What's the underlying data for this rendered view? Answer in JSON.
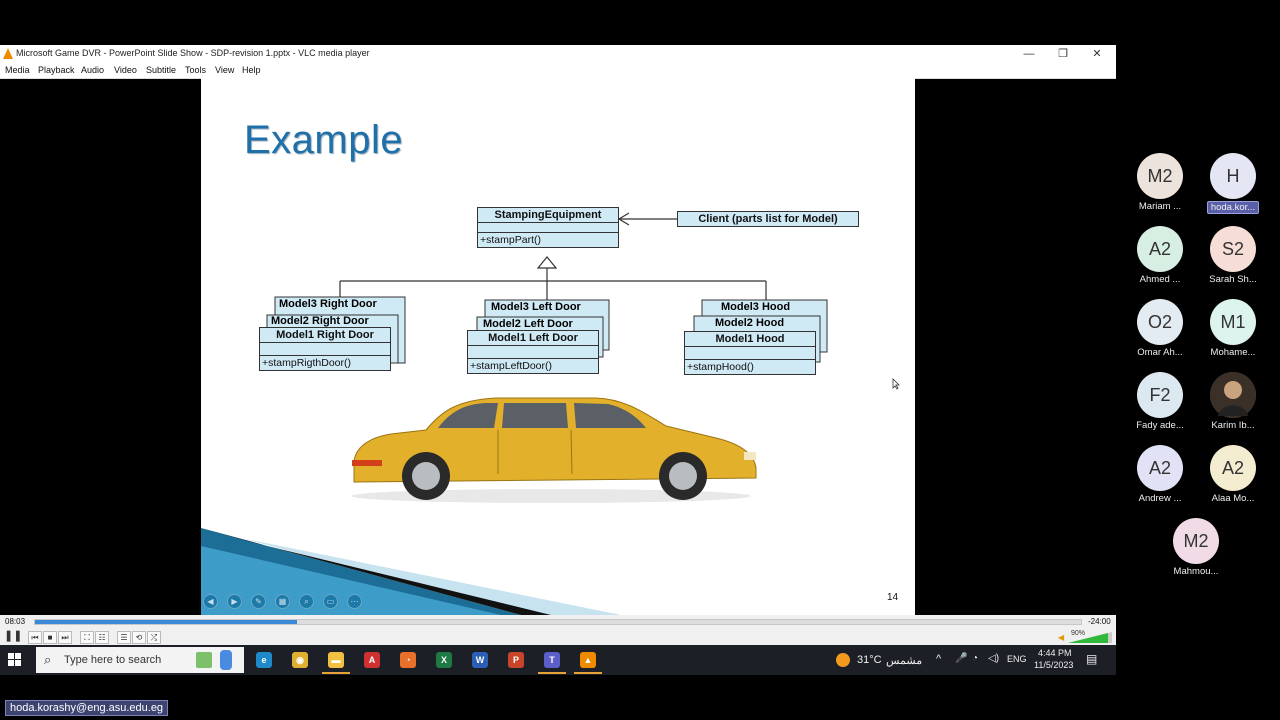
{
  "window": {
    "title": "Microsoft Game DVR - PowerPoint Slide Show  -  SDP-revision 1.pptx - VLC media player",
    "controls": [
      "—",
      "❐",
      "✕"
    ]
  },
  "menu": [
    "Media",
    "Playback",
    "Audio",
    "Video",
    "Subtitle",
    "Tools",
    "View",
    "Help"
  ],
  "slide": {
    "title": "Example",
    "number": "14",
    "uml": {
      "stamping_equipment": {
        "name": "StampingEquipment",
        "op": "+stampPart()"
      },
      "client": "Client (parts list for Model)",
      "right_door": {
        "names": [
          "Model3 Right Door",
          "Model2 Right Door",
          "Model1 Right Door"
        ],
        "op": "+stampRigthDoor()"
      },
      "left_door": {
        "names": [
          "Model3 Left Door",
          "Model2 Left Door",
          "Model1  Left  Door"
        ],
        "op": "+stampLeftDoor()"
      },
      "hood": {
        "names": [
          "Model3 Hood",
          "Model2 Hood",
          "Model1 Hood"
        ],
        "op": "+stampHood()"
      }
    }
  },
  "player": {
    "elapsed": "08:03",
    "remaining": "-24:00",
    "progress": 0.25,
    "volume": "90%"
  },
  "taskbar": {
    "search_placeholder": "Type here to search",
    "weather": "31°C",
    "weather_label": "مشمس",
    "lang": "ENG",
    "time": "4:44 PM",
    "date": "11/5/2023",
    "apps": [
      {
        "name": "edge",
        "color": "#1e88c8"
      },
      {
        "name": "chrome",
        "color": "#e0b030"
      },
      {
        "name": "file-explorer",
        "color": "#f0c040"
      },
      {
        "name": "acrobat",
        "color": "#d03030"
      },
      {
        "name": "firefox",
        "color": "#e8702a"
      },
      {
        "name": "excel",
        "color": "#1d7a45"
      },
      {
        "name": "word",
        "color": "#2b5fb5"
      },
      {
        "name": "powerpoint",
        "color": "#c8452a"
      },
      {
        "name": "teams",
        "color": "#5b5fc7"
      },
      {
        "name": "vlc",
        "color": "#f08a00"
      }
    ]
  },
  "participants": [
    {
      "initials": "M2",
      "name": "Mariam ...",
      "color": "#ece3dc"
    },
    {
      "initials": "H",
      "name": "hoda.kor...",
      "color": "#e4e6f3",
      "highlight": true
    },
    {
      "initials": "A2",
      "name": "Ahmed ...",
      "color": "#d7efe3"
    },
    {
      "initials": "S2",
      "name": "Sarah Sh...",
      "color": "#f6ddd6"
    },
    {
      "initials": "O2",
      "name": "Omar Ah...",
      "color": "#e3ecf3"
    },
    {
      "initials": "M1",
      "name": "Mohame...",
      "color": "#dcf3ee"
    },
    {
      "initials": "F2",
      "name": "Fady ade...",
      "color": "#dde9f1"
    },
    {
      "initials": "",
      "name": "Karim Ib...",
      "color": "#6b5a48",
      "photo": true
    },
    {
      "initials": "A2",
      "name": "Andrew ...",
      "color": "#e2e2f6"
    },
    {
      "initials": "A2",
      "name": "Alaa Mo...",
      "color": "#f4ecd0"
    },
    {
      "initials": "M2",
      "name": "Mahmou...",
      "color": "#f1dbe7"
    }
  ],
  "email": "hoda.korashy@eng.asu.edu.eg"
}
